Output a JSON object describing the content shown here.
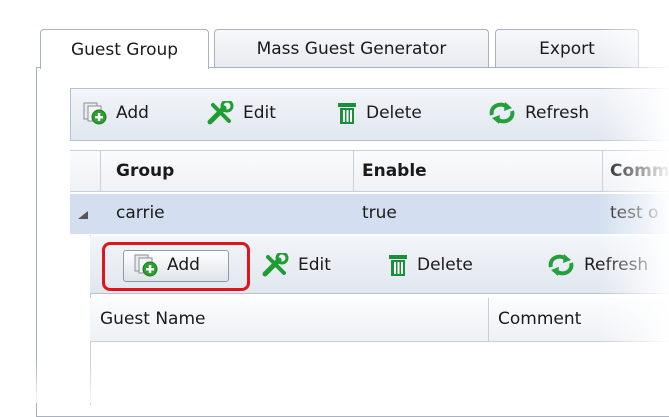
{
  "tabs": [
    {
      "label": "Guest Group"
    },
    {
      "label": "Mass Guest Generator"
    },
    {
      "label": "Export"
    }
  ],
  "group_toolbar": {
    "add_label": "Add",
    "edit_label": "Edit",
    "delete_label": "Delete",
    "refresh_label": "Refresh"
  },
  "group_table": {
    "columns": [
      "Group",
      "Enable",
      "Comment"
    ],
    "rows": [
      {
        "group": "carrie",
        "enable": "true",
        "comment": "test o"
      }
    ]
  },
  "guest_toolbar": {
    "add_label": "Add",
    "edit_label": "Edit",
    "delete_label": "Delete",
    "refresh_label": "Refresh"
  },
  "guest_table": {
    "columns": [
      "Guest Name",
      "Comment"
    ]
  },
  "colors": {
    "highlight": "#e0141b",
    "selected_row": "#d3dff0",
    "add_icon_green": "#2ea02e",
    "edit_icon_green": "#1f9d32",
    "delete_icon_green": "#1a8f3a",
    "refresh_icon_green": "#23a03b"
  }
}
